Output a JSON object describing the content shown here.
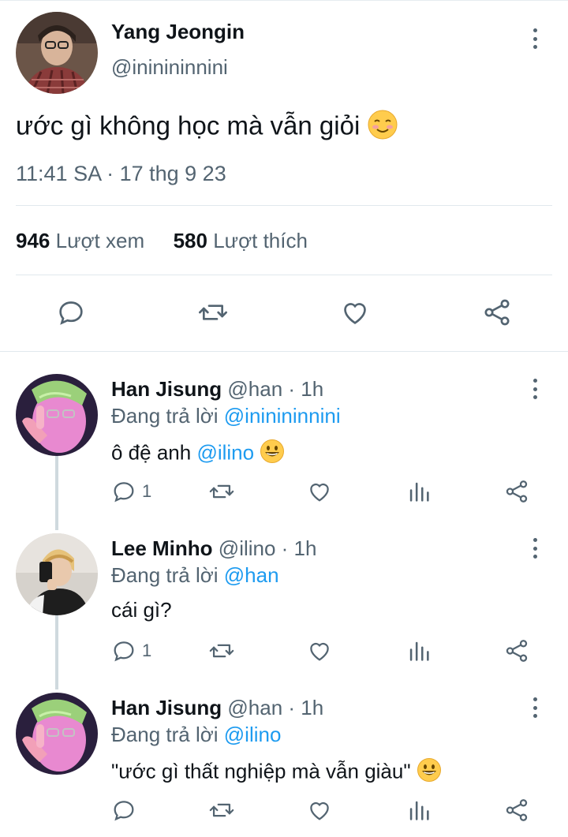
{
  "main_tweet": {
    "name": "Yang Jeongin",
    "handle": "@ininininnini",
    "text": "ước gì không học mà vẫn giỏi",
    "emoji": "smiling-face-icon",
    "timestamp": "11:41 SA · 17 thg 9 23",
    "views_count": "946",
    "views_label": "Lượt xem",
    "likes_count": "580",
    "likes_label": "Lượt thích"
  },
  "replies": [
    {
      "name": "Han Jisung",
      "meta": "@han · 1h",
      "replying_prefix": "Đang trả lời ",
      "replying_to": "@ininininnini",
      "text_prefix": "ô đệ anh ",
      "mention": "@ilino",
      "text_suffix": "",
      "emoji": "grinning-face-icon",
      "reply_count": "1"
    },
    {
      "name": "Lee Minho",
      "meta": "@ilino · 1h",
      "replying_prefix": "Đang trả lời ",
      "replying_to": "@han",
      "text_prefix": "cái gì?",
      "mention": "",
      "text_suffix": "",
      "emoji": "",
      "reply_count": "1"
    },
    {
      "name": "Han Jisung",
      "meta": "@han · 1h",
      "replying_prefix": "Đang trả lời ",
      "replying_to": "@ilino",
      "text_prefix": "\"ước gì thất nghiệp mà vẫn giàu\"",
      "mention": "",
      "text_suffix": "",
      "emoji": "grinning-face-icon",
      "reply_count": ""
    }
  ],
  "colors": {
    "accent": "#1d9bf0",
    "secondary_text": "#536471",
    "primary_text": "#0f1419",
    "divider": "#e1e8ed"
  }
}
